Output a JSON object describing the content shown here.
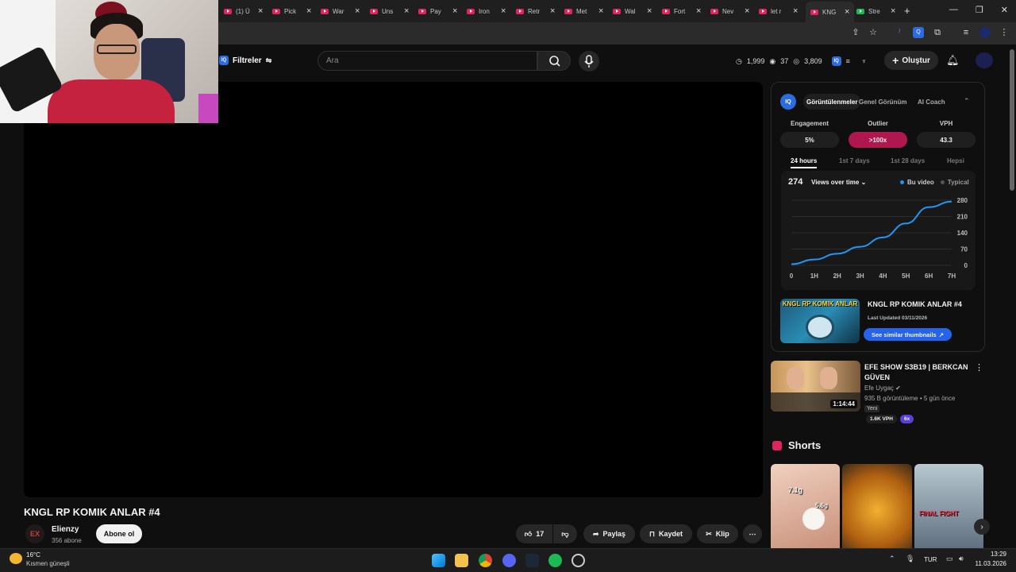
{
  "browser": {
    "tabs": [
      {
        "label": "(1) Ü"
      },
      {
        "label": "Pick"
      },
      {
        "label": "War"
      },
      {
        "label": "Uns"
      },
      {
        "label": "Pay"
      },
      {
        "label": "Iron"
      },
      {
        "label": "Retr"
      },
      {
        "label": "Met"
      },
      {
        "label": "Wal"
      },
      {
        "label": "Fort"
      },
      {
        "label": "Nev"
      },
      {
        "label": "let r"
      },
      {
        "label": "KNG"
      },
      {
        "label": "Stre"
      }
    ],
    "new_tab": "+",
    "controls": {
      "minimize": "—",
      "restore": "❐",
      "close": "✕"
    }
  },
  "header": {
    "filters_label": "Filtreler",
    "search_placeholder": "Ara",
    "stats": {
      "views": "1,999",
      "visible": "37",
      "eye": "3,809"
    },
    "create_label": "Oluştur"
  },
  "video": {
    "title": "KNGL RP KOMIK ANLAR #4",
    "channel_initials": "EX",
    "channel": "Elienzy",
    "subscribers": "356 abone",
    "subscribe_label": "Abone ol",
    "likes": "17",
    "share_label": "Paylaş",
    "save_label": "Kaydet",
    "clip_label": "Klip"
  },
  "iq": {
    "badge": "IQ",
    "tabs": [
      "Görüntülenmeler",
      "Genel Görünüm",
      "AI Coach"
    ],
    "metrics": [
      {
        "label": "Engagement",
        "value": "5%"
      },
      {
        "label": "Outlier",
        "value": ">100x"
      },
      {
        "label": "VPH",
        "value": "43.3"
      }
    ],
    "ranges": [
      "24 hours",
      "1st 7 days",
      "1st 28 days",
      "Hepsi"
    ],
    "chart_total": "274",
    "chart_selector": "Views over time",
    "legend": {
      "this_video": "Bu video",
      "typical": "Typical"
    },
    "card": {
      "title": "KNGL RP KOMIK ANLAR #4",
      "updated": "Last Updated 03/11/2026",
      "similar_label": "See similar thumbnails",
      "thumb_text": "KNGL RP KOMIK ANLAR"
    },
    "colors": {
      "accent": "#2196f3",
      "outlier": "#b0174f"
    }
  },
  "chart_data": {
    "type": "line",
    "x": [
      "0",
      "1H",
      "2H",
      "3H",
      "4H",
      "5H",
      "6H",
      "7H"
    ],
    "series": [
      {
        "name": "Bu video",
        "values": [
          5,
          25,
          50,
          80,
          120,
          180,
          250,
          274
        ]
      }
    ],
    "y_ticks": [
      0,
      70,
      140,
      210,
      280
    ],
    "ylim": [
      0,
      280
    ],
    "legend_position": "top-right"
  },
  "recommendation": {
    "title_line1": "EFE SHOW S3B19 | BERKCAN",
    "title_line2": "GÜVEN",
    "channel": "Efe Uygaç",
    "meta": "935 B görüntüleme • 5 gün önce",
    "badge_new": "Yeni",
    "duration": "1:14:44",
    "vph": "1.6K VPH",
    "multiplier": "6x"
  },
  "shorts": {
    "heading": "Shorts",
    "thumb1_text1": "7.1g",
    "thumb1_text2": "5.6g",
    "thumb3_text": "FINAL FIGHT"
  },
  "taskbar": {
    "temp": "16°C",
    "weather": "Kısmen güneşli",
    "lang": "TUR",
    "time": "13:29",
    "date": "11.03.2026"
  }
}
